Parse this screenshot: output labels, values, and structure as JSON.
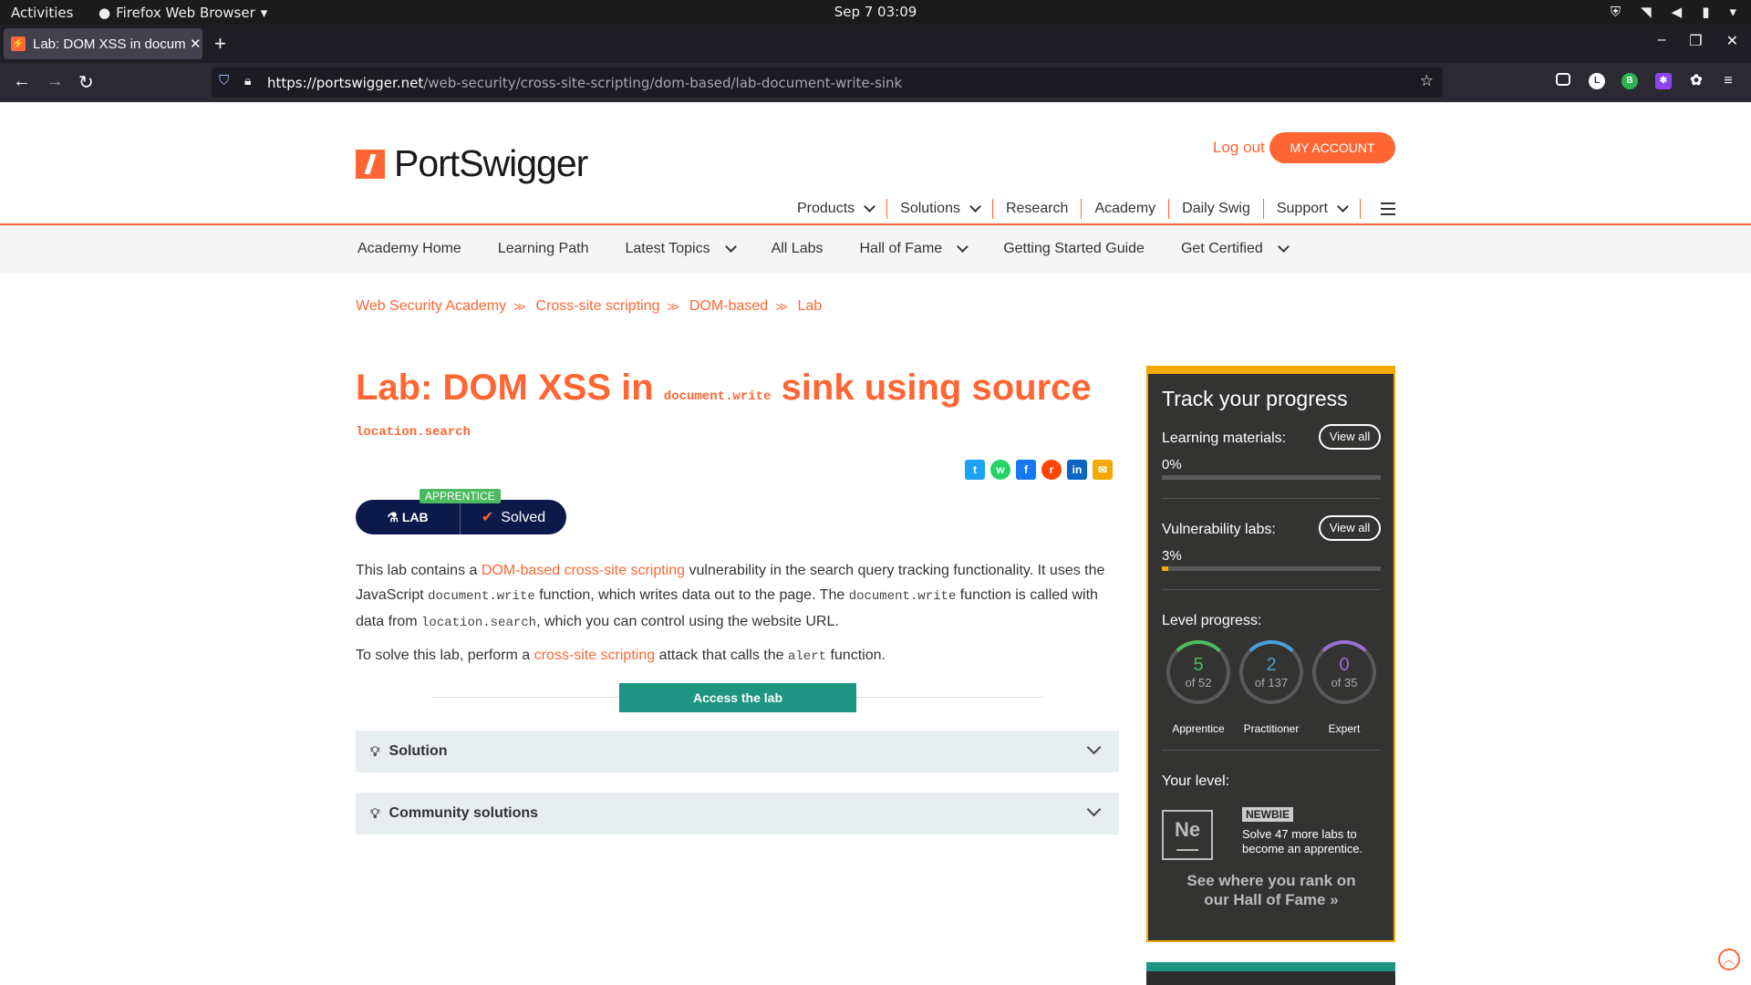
{
  "os": {
    "activities": "Activities",
    "app_name": "Firefox Web Browser",
    "clock": "Sep 7  03:09"
  },
  "browser": {
    "tab_title": "Lab: DOM XSS in document",
    "url_host": "https://portswigger.net",
    "url_path": "/web-security/cross-site-scripting/dom-based/lab-document-write-sink"
  },
  "header": {
    "logo_text": "PortSwigger",
    "logout": "Log out",
    "my_account": "MY ACCOUNT",
    "nav": [
      "Products",
      "Solutions",
      "Research",
      "Academy",
      "Daily Swig",
      "Support"
    ]
  },
  "subnav": [
    "Academy Home",
    "Learning Path",
    "Latest Topics",
    "All Labs",
    "Hall of Fame",
    "Getting Started Guide",
    "Get Certified"
  ],
  "breadcrumbs": [
    "Web Security Academy",
    "Cross-site scripting",
    "DOM-based",
    "Lab"
  ],
  "lab": {
    "title_prefix": "Lab: DOM XSS in ",
    "title_code": "document.write",
    "title_suffix": " sink using source",
    "title_source": "location.search",
    "level_badge": "APPRENTICE",
    "lab_label": "LAB",
    "status": "Solved",
    "desc1_a": "This lab contains a ",
    "desc1_link": "DOM-based cross-site scripting",
    "desc1_b": " vulnerability in the search query tracking functionality. It uses the JavaScript ",
    "desc1_code1": "document.write",
    "desc1_c": " function, which writes data out to the page. The ",
    "desc1_code2": "document.write",
    "desc1_d": " function is called with data from ",
    "desc1_code3": "location.search",
    "desc1_e": ", which you can control using the website URL.",
    "desc2_a": "To solve this lab, perform a ",
    "desc2_link": "cross-site scripting",
    "desc2_b": " attack that calls the ",
    "desc2_code": "alert",
    "desc2_c": " function.",
    "access_button": "Access the lab",
    "solution": "Solution",
    "community": "Community solutions"
  },
  "progress": {
    "heading": "Track your progress",
    "learning_label": "Learning materials:",
    "learning_pct": "0%",
    "learning_value": 0,
    "vuln_label": "Vulnerability labs:",
    "vuln_pct": "3%",
    "vuln_value": 0.03,
    "view_all": "View all",
    "level_label": "Level progress:",
    "levels": [
      {
        "n": "5",
        "of": "of 52",
        "name": "Apprentice",
        "color": "#4cbb5f"
      },
      {
        "n": "2",
        "of": "of 137",
        "name": "Practitioner",
        "color": "#4a9fd8"
      },
      {
        "n": "0",
        "of": "of 35",
        "name": "Expert",
        "color": "#9b6fd1"
      }
    ],
    "your_level": "Your level:",
    "level_symbol": "Ne",
    "newbie": "NEWBIE",
    "level_text": "Solve 47 more labs to become an apprentice.",
    "rank_text": "See where you rank on our Hall of Fame"
  },
  "colors": {
    "accent": "#ff6633",
    "teal": "#1e9482",
    "navy": "#0c1a4b",
    "gold": "#f5a800"
  }
}
